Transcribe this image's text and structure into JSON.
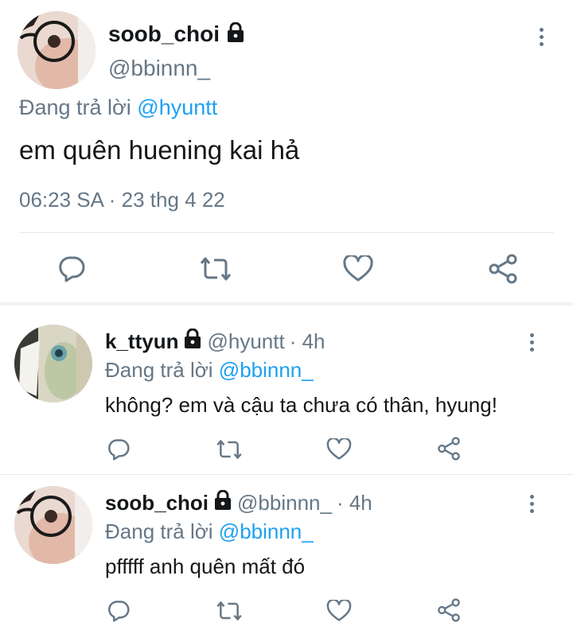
{
  "main_tweet": {
    "display_name": "soob_choi",
    "handle": "@bbinnn_",
    "reply_prefix": "Đang trả lời",
    "reply_mention": "@hyuntt",
    "text": "em quên huening kai hả",
    "timestamp": "06:23 SA · 23 thg 4 22",
    "protected_icon": "lock-icon"
  },
  "replies": [
    {
      "display_name": "k_ttyun",
      "handle": "@hyuntt",
      "time": "· 4h",
      "reply_prefix": "Đang trả lời",
      "reply_mention": "@bbinnn_",
      "text": "không? em và cậu ta chưa có thân, hyung!"
    },
    {
      "display_name": "soob_choi",
      "handle": "@bbinnn_",
      "time": "· 4h",
      "reply_prefix": "Đang trả lời",
      "reply_mention": "@bbinnn_",
      "text": "pfffff anh quên mất đó"
    }
  ],
  "actions": [
    "reply-icon",
    "retweet-icon",
    "like-icon",
    "share-icon"
  ],
  "colors": {
    "accent": "#1da1f2",
    "secondary_text": "#657786",
    "icon": "#657786",
    "divider": "#e1e8ed"
  }
}
